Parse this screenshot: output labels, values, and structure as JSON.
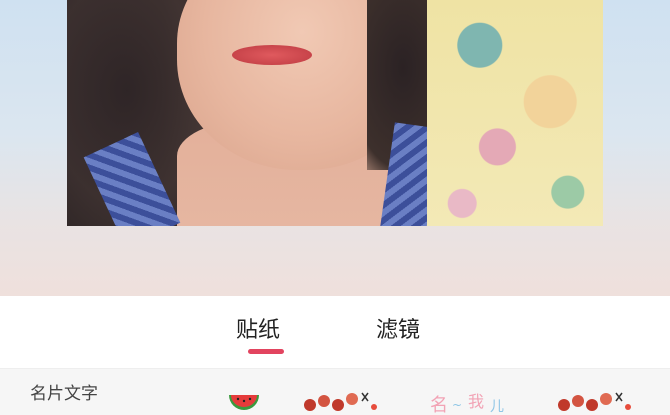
{
  "tabs": [
    {
      "label": "贴纸",
      "active": true
    },
    {
      "label": "滤镜",
      "active": false
    }
  ],
  "accent_color": "#e2445f",
  "sticker_section": {
    "title": "名片文字",
    "items": [
      {
        "icon": "watermelon-sticker-icon"
      },
      {
        "icon": "flower-text-sticker-icon"
      },
      {
        "icon": "pastel-text-sticker-icon"
      },
      {
        "icon": "flower-text-sticker-icon"
      }
    ]
  }
}
